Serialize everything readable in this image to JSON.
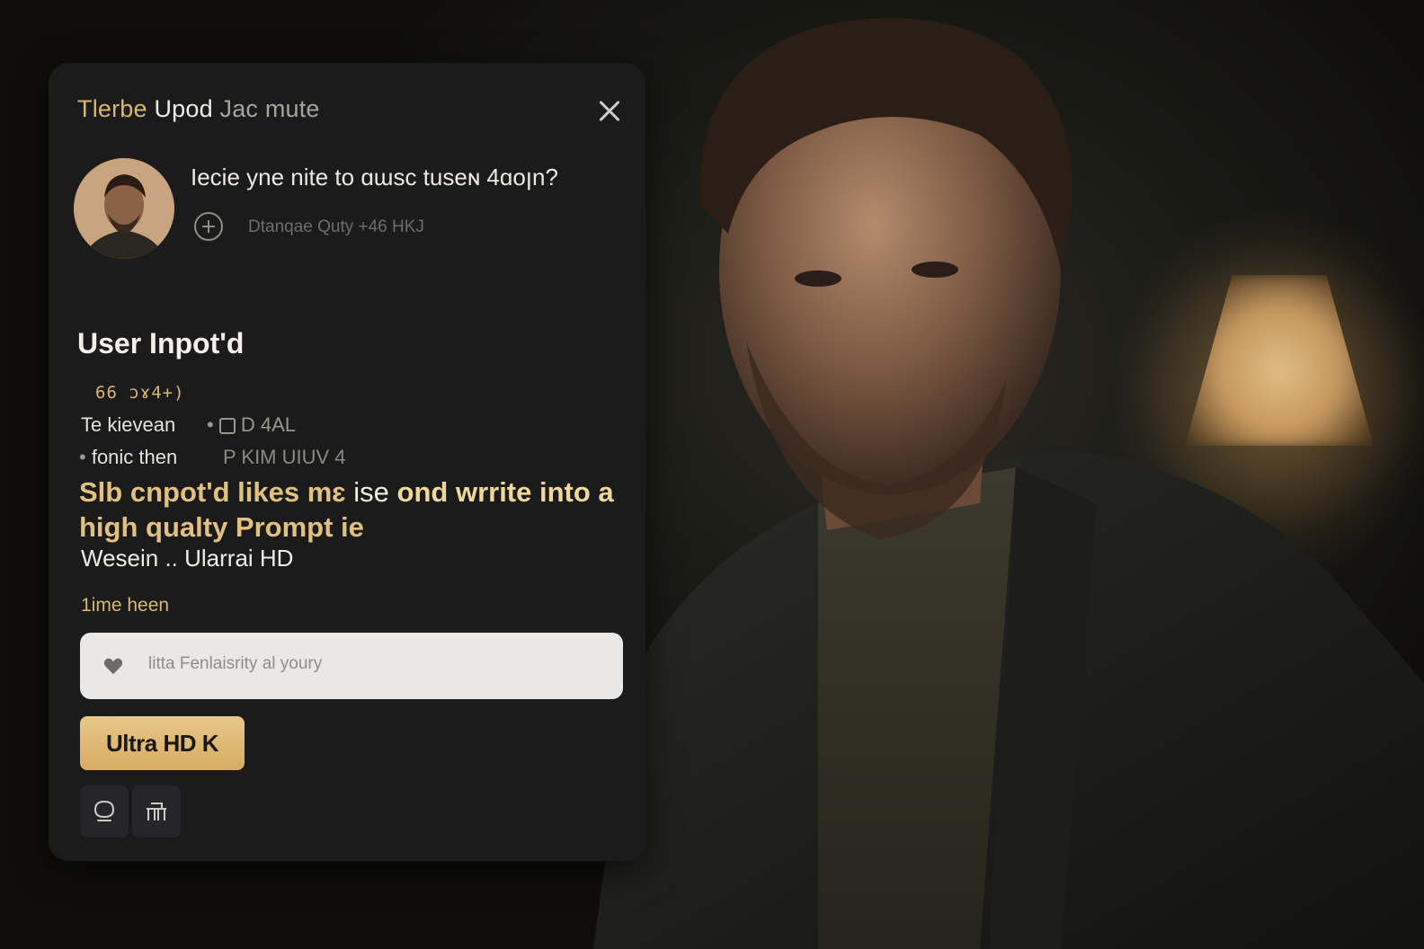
{
  "panel": {
    "title_part1": "Tlerbe",
    "title_part2": "Upod",
    "title_part3": "Jac mute",
    "close_icon": "close-icon",
    "question": "Iecie yne nite to ɑɯsc tuseɴ 4ɑoꞁn?",
    "sub_meta": "Dtanqae Quty +46 HKJ",
    "section_heading": "User Inpot'd",
    "gold_code": "66  ɔɤ4+)",
    "row1_left": "Te kievean",
    "row1_right": "D 4AL",
    "row2_left": "fonic then",
    "row2_right": "P KIM UIUV 4",
    "highlight_part1": "Slb cnpot'd likes mɛ",
    "highlight_part2": " ise ",
    "highlight_part3": "ond wrrite into a",
    "highlight_part4": "high qualty Prompt ie",
    "subline": "Wesein .. Ularrai HD",
    "input_label": "1ime heen",
    "input_value": "litta Fenlaisrity al youry",
    "primary_button": "Ultra HD K",
    "icons": [
      "close-icon",
      "plus-circle-icon",
      "heart-icon",
      "chat-bubble-icon",
      "table-icon"
    ]
  },
  "colors": {
    "accent_gold": "#d9b772",
    "panel_bg": "#1b1b1c",
    "button_gold": "#e0bd78"
  }
}
